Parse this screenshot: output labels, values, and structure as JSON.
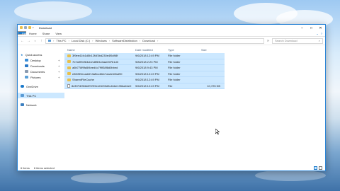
{
  "window": {
    "title": "Download",
    "controls": [
      "minimize",
      "maximize",
      "close"
    ]
  },
  "ribbon": {
    "tabs": [
      "File",
      "Home",
      "Share",
      "View"
    ]
  },
  "address": {
    "segments": [
      "This PC",
      "Local Disk (C:)",
      "Windows",
      "SoftwareDistribution",
      "Download"
    ],
    "search_placeholder": "Search Download"
  },
  "sidebar": {
    "items": [
      {
        "label": "Quick access",
        "icon": "star-icon",
        "sub": false,
        "pinned": false
      },
      {
        "label": "Desktop",
        "icon": "desktop-icon",
        "sub": true,
        "pinned": true
      },
      {
        "label": "Downloads",
        "icon": "download-icon",
        "sub": true,
        "pinned": true
      },
      {
        "label": "Documents",
        "icon": "documents-icon",
        "sub": true,
        "pinned": true
      },
      {
        "label": "Pictures",
        "icon": "pictures-icon",
        "sub": true,
        "pinned": true
      },
      {
        "label": "OneDrive",
        "icon": "cloud-icon",
        "sub": false,
        "pinned": false
      },
      {
        "label": "This PC",
        "icon": "computer-icon",
        "sub": false,
        "pinned": false,
        "selected": true
      },
      {
        "label": "Network",
        "icon": "network-icon",
        "sub": false,
        "pinned": false
      }
    ]
  },
  "columns": {
    "name": "Name",
    "date": "Date modified",
    "type": "Type",
    "size": "Size"
  },
  "files": [
    {
      "name": "3f9ee41fc1d5b12f4f3bd230e4f5d98f",
      "date": "9/6/2018 12:49 PM",
      "type": "File folder",
      "size": "",
      "kind": "folder"
    },
    {
      "name": "7b7a9f9efb3cb2c8f5f4c0aa03f7b1d3",
      "date": "9/8/2018 2:23 PM",
      "type": "File folder",
      "size": "",
      "kind": "folder"
    },
    {
      "name": "a6b778f9fa5f4eed4c7f9f38f8d0bbed",
      "date": "9/6/2018 9:43 PM",
      "type": "File folder",
      "size": "",
      "kind": "folder"
    },
    {
      "name": "e8f4f39ecad4f13afbcd82c7aa4e1ffad90",
      "date": "9/6/2018 12:49 PM",
      "type": "File folder",
      "size": "",
      "kind": "folder"
    },
    {
      "name": "SharedFileCache",
      "date": "9/6/2018 12:49 PM",
      "type": "File folder",
      "size": "",
      "kind": "folder"
    },
    {
      "name": "8ef07f4f3f4b8f7299ee01f03d9c4bbe135ba4be0",
      "date": "9/6/2018 12:49 PM",
      "type": "File",
      "size": "10,725 KB",
      "kind": "file"
    }
  ],
  "status": {
    "count": "6 items",
    "selected": "6 items selected"
  },
  "colors": {
    "accent": "#1979ca",
    "selection": "#cce8ff",
    "folder": "#e8c04b"
  }
}
